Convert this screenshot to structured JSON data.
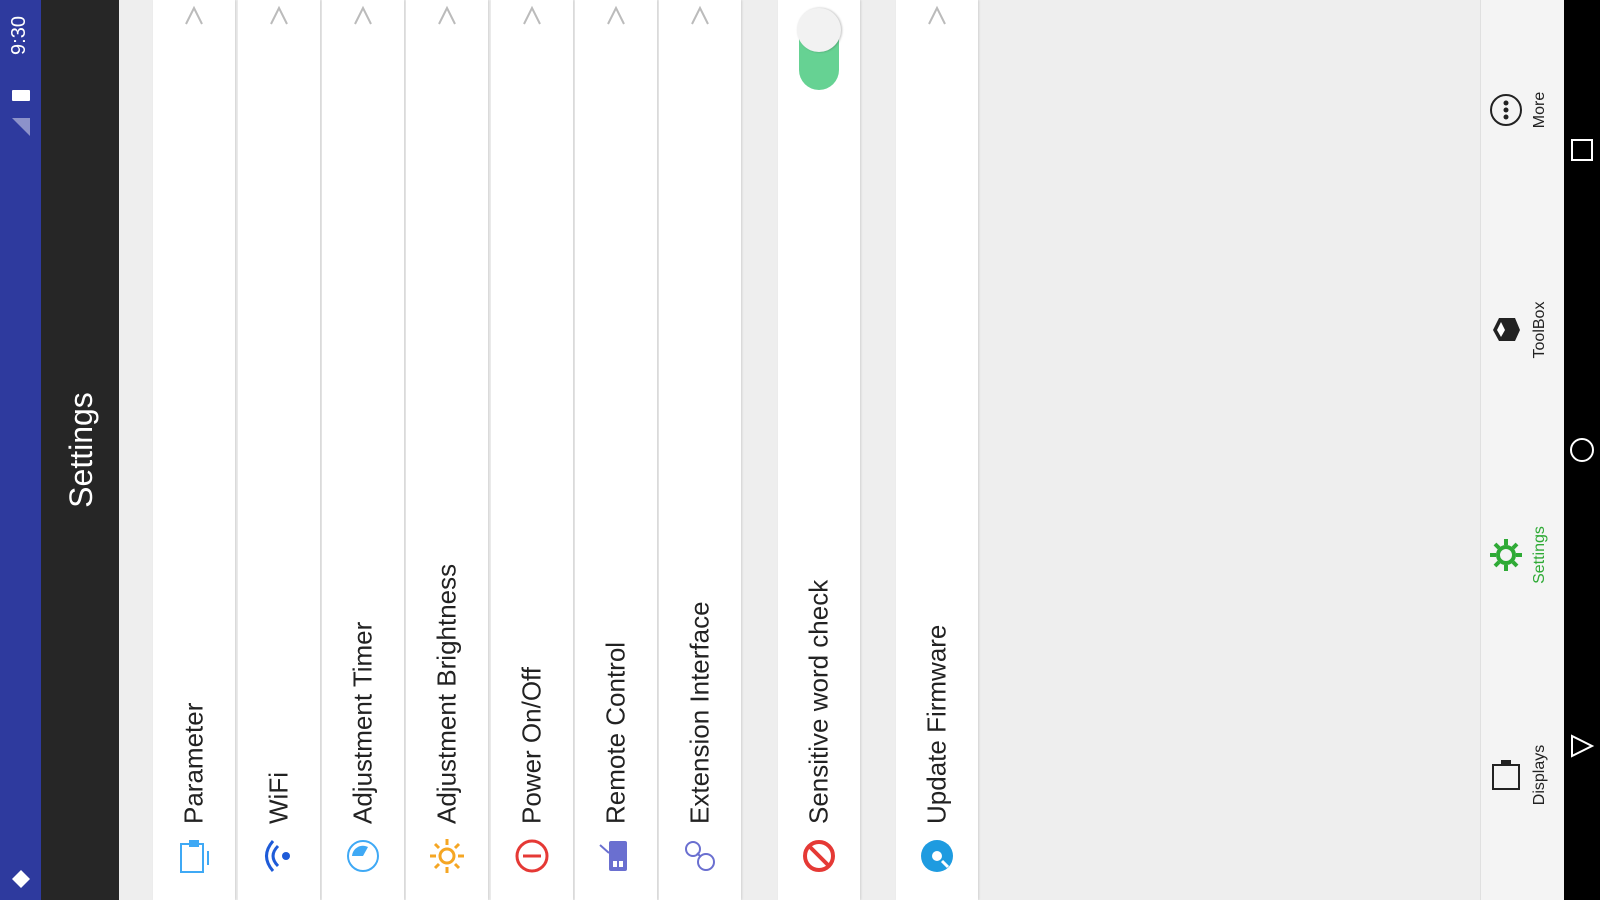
{
  "status_bar": {
    "time": "9:30"
  },
  "toolbar": {
    "title": "Settings"
  },
  "settings": [
    {
      "label": "Parameter",
      "icon": "monitor-icon",
      "color": "#3fa9f5",
      "control": "chevron"
    },
    {
      "label": "WiFi",
      "icon": "wifi-icon",
      "color": "#1e5bd8",
      "control": "chevron"
    },
    {
      "label": "Adjustment Timer",
      "icon": "timer-icon",
      "color": "#3fa9f5",
      "control": "chevron"
    },
    {
      "label": "Adjustment Brightness",
      "icon": "sun-icon",
      "color": "#f5a623",
      "control": "chevron"
    },
    {
      "label": "Power On/Off",
      "icon": "power-icon",
      "color": "#e53935",
      "control": "chevron"
    },
    {
      "label": "Remote Control",
      "icon": "remote-icon",
      "color": "#6a6fd0",
      "control": "chevron"
    },
    {
      "label": "Extension Interface",
      "icon": "plug-icon",
      "color": "#6a6fd0",
      "control": "chevron"
    },
    {
      "label": "Sensitive word check",
      "icon": "block-icon",
      "color": "#e53935",
      "control": "toggle",
      "toggle_on": true
    },
    {
      "label": "Update Firmware",
      "icon": "firmware-icon",
      "color": "#1e9be0",
      "control": "chevron"
    }
  ],
  "bottom_nav": [
    {
      "label": "Displays",
      "icon": "display-icon",
      "active": false
    },
    {
      "label": "Settings",
      "icon": "gear-icon",
      "active": true
    },
    {
      "label": "ToolBox",
      "icon": "toolbox-icon",
      "active": false
    },
    {
      "label": "More",
      "icon": "more-icon",
      "active": false
    }
  ],
  "colors": {
    "status_bar": "#2e3a9e",
    "toolbar": "#262626",
    "accent_green": "#2eaa35",
    "toggle": "#66d293"
  }
}
